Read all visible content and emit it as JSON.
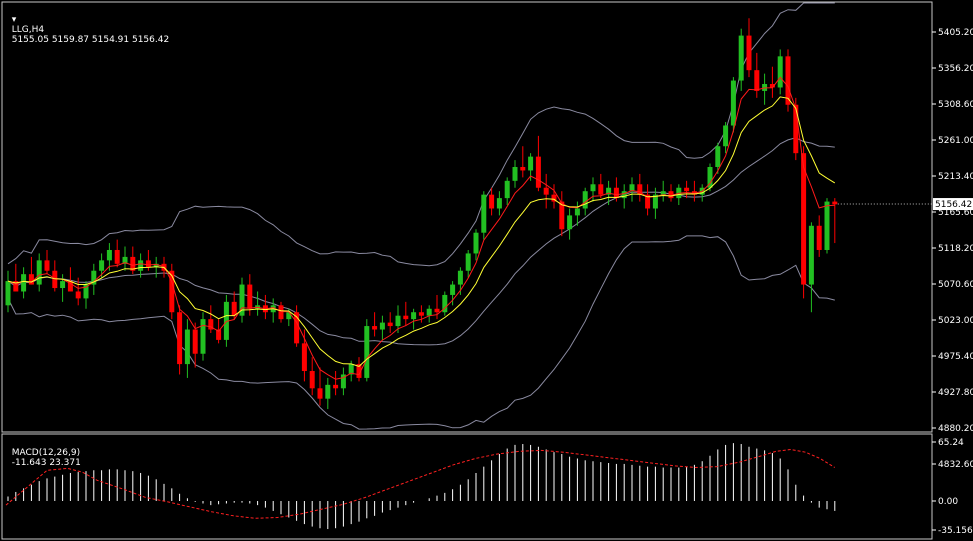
{
  "header": {
    "symbol_label": "LLG,H4",
    "ohlc_text": "5155.05 5159.87 5154.91 5156.42",
    "macd_label": "MACD(12,26,9)",
    "macd_values_text": "-11.643 23.371"
  },
  "colors": {
    "background": "#000000",
    "bull": "#22c022",
    "bear": "#ff0000",
    "bands": "#8a8aa0",
    "ma_fast": "#ff1a1a",
    "ma_slow": "#ffff33",
    "macd_hist": "#ffffff",
    "macd_signal": "#ff2020",
    "frame": "#c8c8c8"
  },
  "chart_data": [
    {
      "type": "candlestick",
      "title": "LLG,H4",
      "current_price": "5156.42",
      "y_ticks": [
        "5405.20",
        "5356.20",
        "5308.60",
        "5261.00",
        "5213.40",
        "5165.60",
        "5118.20",
        "5070.60",
        "5023.00",
        "4975.40",
        "4927.80",
        "4880.20",
        "4832.60"
      ],
      "ylim": [
        4832.6,
        5440
      ],
      "candles": [
        [
          5010,
          5060,
          5000,
          5045
        ],
        [
          5045,
          5070,
          5030,
          5030
        ],
        [
          5030,
          5065,
          5020,
          5055
        ],
        [
          5055,
          5080,
          5040,
          5040
        ],
        [
          5040,
          5085,
          5030,
          5075
        ],
        [
          5075,
          5090,
          5055,
          5060
        ],
        [
          5060,
          5075,
          5030,
          5035
        ],
        [
          5035,
          5055,
          5015,
          5045
        ],
        [
          5045,
          5065,
          5030,
          5030
        ],
        [
          5030,
          5050,
          5010,
          5020
        ],
        [
          5020,
          5045,
          5005,
          5040
        ],
        [
          5040,
          5070,
          5025,
          5060
        ],
        [
          5060,
          5085,
          5050,
          5075
        ],
        [
          5075,
          5100,
          5060,
          5090
        ],
        [
          5090,
          5105,
          5065,
          5070
        ],
        [
          5070,
          5095,
          5060,
          5080
        ],
        [
          5080,
          5095,
          5055,
          5060
        ],
        [
          5060,
          5085,
          5050,
          5075
        ],
        [
          5075,
          5090,
          5060,
          5065
        ],
        [
          5065,
          5080,
          5050,
          5070
        ],
        [
          5070,
          5080,
          5050,
          5060
        ],
        [
          5060,
          5070,
          4990,
          5000
        ],
        [
          5000,
          5010,
          4910,
          4925
        ],
        [
          4925,
          4990,
          4905,
          4975
        ],
        [
          4975,
          4985,
          4920,
          4940
        ],
        [
          4940,
          5000,
          4930,
          4990
        ],
        [
          4990,
          5010,
          4970,
          4975
        ],
        [
          4975,
          4990,
          4955,
          4960
        ],
        [
          4960,
          5025,
          4950,
          5015
        ],
        [
          5015,
          5030,
          4990,
          4995
        ],
        [
          4995,
          5050,
          4985,
          5040
        ],
        [
          5040,
          5055,
          4995,
          5005
        ],
        [
          5005,
          5030,
          4995,
          5010
        ],
        [
          5010,
          5025,
          4990,
          5000
        ],
        [
          5000,
          5020,
          4985,
          5010
        ],
        [
          5010,
          5015,
          4985,
          4990
        ],
        [
          4990,
          5005,
          4980,
          5000
        ],
        [
          5000,
          5010,
          4950,
          4955
        ],
        [
          4955,
          4975,
          4900,
          4915
        ],
        [
          4915,
          4935,
          4880,
          4890
        ],
        [
          4890,
          4920,
          4865,
          4875
        ],
        [
          4875,
          4905,
          4860,
          4895
        ],
        [
          4895,
          4915,
          4880,
          4890
        ],
        [
          4890,
          4920,
          4880,
          4910
        ],
        [
          4910,
          4930,
          4900,
          4925
        ],
        [
          4925,
          4935,
          4900,
          4905
        ],
        [
          4905,
          4990,
          4900,
          4980
        ],
        [
          4980,
          5000,
          4965,
          4975
        ],
        [
          4975,
          4995,
          4960,
          4985
        ],
        [
          4985,
          5000,
          4970,
          4980
        ],
        [
          4980,
          5010,
          4970,
          4995
        ],
        [
          4995,
          5015,
          4980,
          4990
        ],
        [
          4990,
          5005,
          4975,
          5000
        ],
        [
          5000,
          5010,
          4985,
          4995
        ],
        [
          4995,
          5010,
          4985,
          5005
        ],
        [
          5005,
          5025,
          4990,
          5000
        ],
        [
          5000,
          5030,
          4995,
          5025
        ],
        [
          5025,
          5045,
          5010,
          5040
        ],
        [
          5040,
          5065,
          5025,
          5060
        ],
        [
          5060,
          5090,
          5050,
          5085
        ],
        [
          5085,
          5120,
          5075,
          5115
        ],
        [
          5115,
          5175,
          5105,
          5170
        ],
        [
          5170,
          5180,
          5140,
          5150
        ],
        [
          5150,
          5175,
          5140,
          5165
        ],
        [
          5165,
          5195,
          5155,
          5190
        ],
        [
          5190,
          5220,
          5180,
          5210
        ],
        [
          5210,
          5240,
          5195,
          5205
        ],
        [
          5205,
          5230,
          5190,
          5225
        ],
        [
          5225,
          5255,
          5175,
          5180
        ],
        [
          5180,
          5200,
          5150,
          5170
        ],
        [
          5170,
          5185,
          5150,
          5160
        ],
        [
          5160,
          5175,
          5110,
          5120
        ],
        [
          5120,
          5150,
          5105,
          5140
        ],
        [
          5140,
          5160,
          5125,
          5150
        ],
        [
          5150,
          5180,
          5140,
          5175
        ],
        [
          5175,
          5195,
          5160,
          5185
        ],
        [
          5185,
          5200,
          5165,
          5170
        ],
        [
          5170,
          5190,
          5155,
          5180
        ],
        [
          5180,
          5195,
          5160,
          5165
        ],
        [
          5165,
          5185,
          5150,
          5175
        ],
        [
          5175,
          5195,
          5160,
          5185
        ],
        [
          5185,
          5200,
          5160,
          5170
        ],
        [
          5170,
          5185,
          5140,
          5150
        ],
        [
          5150,
          5180,
          5135,
          5170
        ],
        [
          5170,
          5190,
          5160,
          5175
        ],
        [
          5175,
          5185,
          5160,
          5165
        ],
        [
          5165,
          5185,
          5155,
          5180
        ],
        [
          5180,
          5190,
          5165,
          5175
        ],
        [
          5175,
          5190,
          5160,
          5170
        ],
        [
          5170,
          5185,
          5160,
          5180
        ],
        [
          5180,
          5215,
          5175,
          5210
        ],
        [
          5210,
          5245,
          5200,
          5240
        ],
        [
          5240,
          5275,
          5230,
          5270
        ],
        [
          5270,
          5340,
          5260,
          5335
        ],
        [
          5335,
          5410,
          5320,
          5400
        ],
        [
          5400,
          5425,
          5340,
          5350
        ],
        [
          5350,
          5375,
          5310,
          5320
        ],
        [
          5320,
          5345,
          5300,
          5330
        ],
        [
          5330,
          5355,
          5310,
          5325
        ],
        [
          5325,
          5380,
          5315,
          5370
        ],
        [
          5370,
          5380,
          5290,
          5300
        ],
        [
          5300,
          5310,
          5220,
          5230
        ],
        [
          5230,
          5240,
          5020,
          5040
        ],
        [
          5040,
          5130,
          5000,
          5125
        ],
        [
          5125,
          5140,
          5080,
          5090
        ],
        [
          5090,
          5165,
          5085,
          5160
        ],
        [
          5160,
          5165,
          5100,
          5156
        ]
      ],
      "indicators": [
        "Bollinger Bands",
        "Moving Average (fast)",
        "Moving Average (slow)"
      ]
    },
    {
      "type": "bar",
      "title": "MACD(12,26,9)",
      "y_ticks": [
        "65.24",
        "0.00",
        "-35.156"
      ],
      "ylim": [
        -35.156,
        65.24
      ],
      "histogram": [
        5,
        10,
        14,
        18,
        22,
        25,
        27,
        29,
        31,
        32,
        33,
        34,
        34,
        35,
        35,
        34,
        33,
        31,
        28,
        24,
        19,
        14,
        8,
        3,
        -1,
        -3,
        -5,
        -4,
        -3,
        -2,
        -2,
        -3,
        -5,
        -8,
        -12,
        -16,
        -20,
        -24,
        -28,
        -31,
        -33,
        -34,
        -33,
        -31,
        -28,
        -25,
        -21,
        -18,
        -14,
        -11,
        -8,
        -5,
        -2,
        0,
        3,
        6,
        9,
        13,
        18,
        24,
        31,
        38,
        45,
        52,
        58,
        62,
        63,
        62,
        60,
        57,
        54,
        52,
        49,
        47,
        45,
        44,
        43,
        42,
        41,
        41,
        40,
        39,
        38,
        38,
        37,
        37,
        37,
        38,
        40,
        44,
        50,
        57,
        62,
        64,
        63,
        60,
        58,
        56,
        53,
        47,
        35,
        18,
        6,
        -2,
        -8,
        -10,
        -12
      ],
      "signal_points": [
        [
          0,
          -5
        ],
        [
          15,
          16
        ],
        [
          28,
          34
        ],
        [
          42,
          36
        ],
        [
          52,
          32
        ],
        [
          62,
          23
        ],
        [
          80,
          13
        ],
        [
          95,
          4
        ],
        [
          110,
          -1
        ],
        [
          125,
          -7
        ],
        [
          140,
          -13
        ],
        [
          155,
          -18
        ],
        [
          170,
          -21
        ],
        [
          185,
          -20
        ],
        [
          200,
          -16
        ],
        [
          215,
          -10
        ],
        [
          230,
          -4
        ],
        [
          245,
          4
        ],
        [
          260,
          13
        ],
        [
          275,
          22
        ],
        [
          290,
          31
        ],
        [
          305,
          40
        ],
        [
          320,
          47
        ],
        [
          335,
          52
        ],
        [
          350,
          55
        ],
        [
          365,
          56
        ],
        [
          380,
          54
        ],
        [
          395,
          51
        ],
        [
          410,
          48
        ],
        [
          425,
          45
        ],
        [
          440,
          42
        ],
        [
          455,
          39
        ],
        [
          470,
          37
        ],
        [
          485,
          38
        ],
        [
          500,
          43
        ],
        [
          515,
          50
        ],
        [
          525,
          55
        ],
        [
          535,
          57
        ],
        [
          545,
          54
        ],
        [
          555,
          47
        ],
        [
          565,
          37
        ]
      ]
    }
  ]
}
